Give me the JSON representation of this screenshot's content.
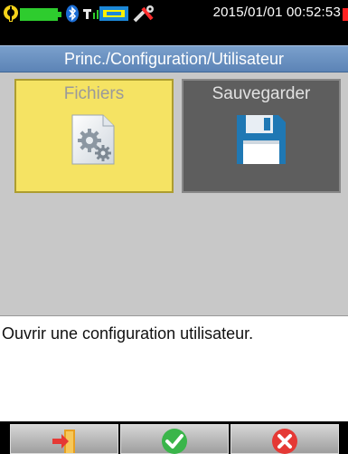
{
  "status_bar": {
    "datetime": "2015/01/01 00:52:53",
    "icons": [
      "phase-icon",
      "battery-icon",
      "bluetooth-icon",
      "signal-icon",
      "wifi-icon",
      "tools-icon",
      "alarm-icon"
    ]
  },
  "title_bar": {
    "breadcrumb": "Princ./Configuration/Utilisateur"
  },
  "tiles": [
    {
      "label": "Fichiers",
      "icon": "settings-file-icon",
      "selected": true
    },
    {
      "label": "Sauvegarder",
      "icon": "floppy-disk-icon",
      "selected": false
    }
  ],
  "description": "Ouvrir une configuration utilisateur.",
  "softkeys": [
    {
      "icon": "exit-icon"
    },
    {
      "icon": "confirm-check-icon"
    },
    {
      "icon": "cancel-x-icon"
    }
  ],
  "colors": {
    "selected_tile": "#f5e363",
    "unselected_tile": "#5e5e5e",
    "title_bar": "#6a92c2",
    "confirm": "#3ab54a",
    "cancel": "#e53935"
  }
}
